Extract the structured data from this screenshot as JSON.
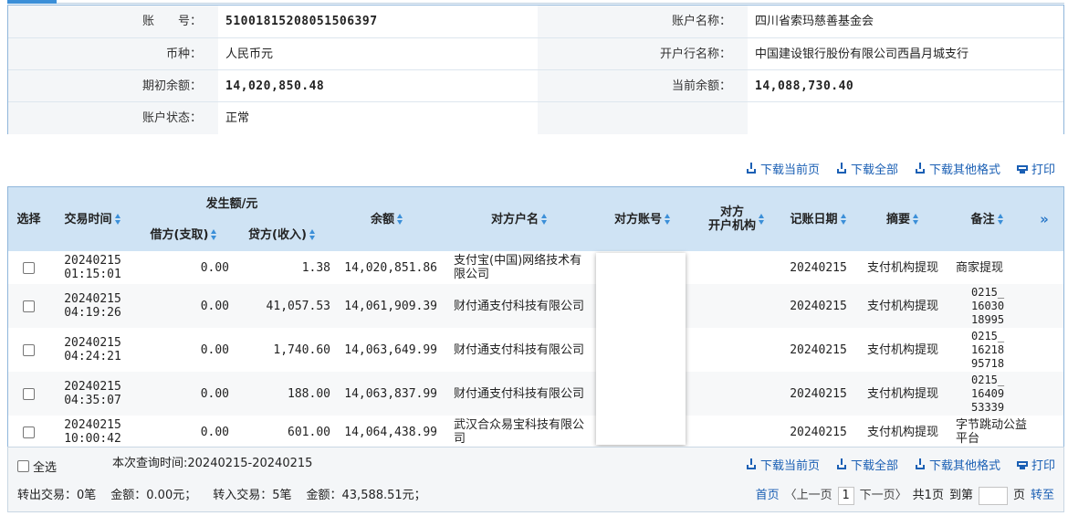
{
  "account": {
    "rows": [
      {
        "label1": "账　　号：",
        "value1": "51001815208051506397",
        "label2": "账户名称：",
        "value2": "四川省索玛慈善基金会"
      },
      {
        "label1": "币种：",
        "value1": "人民币元",
        "label2": "开户行名称：",
        "value2": "中国建设银行股份有限公司西昌月城支行"
      },
      {
        "label1": "期初余额：",
        "value1": "14,020,850.48",
        "label2": "当前余额：",
        "value2": "14,088,730.40"
      },
      {
        "label1": "账户状态：",
        "value1": "正常",
        "label2": "",
        "value2": ""
      }
    ]
  },
  "toolbar": {
    "download_page": "下载当前页",
    "download_all": "下载全部",
    "download_other": "下载其他格式",
    "print": "打印"
  },
  "table": {
    "headers": {
      "select": "选择",
      "time": "交易时间",
      "amount_group": "发生额/元",
      "debit": "借方(支取)",
      "credit": "贷方(收入)",
      "balance": "余额",
      "counterparty_name": "对方户名",
      "counterparty_account": "对方账号",
      "counterparty_bank": "对方\n开户机构",
      "post_date": "记账日期",
      "summary": "摘要",
      "remark": "备注",
      "more": "»"
    },
    "rows": [
      {
        "date": "20240215",
        "time": "01:15:01",
        "debit": "0.00",
        "credit": "1.38",
        "balance": "14,020,851.86",
        "name": "支付宝(中国)网络技术有限公司",
        "post_date": "20240215",
        "summary": "支付机构提现",
        "remark": "商家提现"
      },
      {
        "date": "20240215",
        "time": "04:19:26",
        "debit": "0.00",
        "credit": "41,057.53",
        "balance": "14,061,909.39",
        "name": "财付通支付科技有限公司",
        "post_date": "20240215",
        "summary": "支付机构提现",
        "remark": "0215_\n16030\n18995"
      },
      {
        "date": "20240215",
        "time": "04:24:21",
        "debit": "0.00",
        "credit": "1,740.60",
        "balance": "14,063,649.99",
        "name": "财付通支付科技有限公司",
        "post_date": "20240215",
        "summary": "支付机构提现",
        "remark": "0215_\n16218\n95718"
      },
      {
        "date": "20240215",
        "time": "04:35:07",
        "debit": "0.00",
        "credit": "188.00",
        "balance": "14,063,837.99",
        "name": "财付通支付科技有限公司",
        "post_date": "20240215",
        "summary": "支付机构提现",
        "remark": "0215_\n16409\n53339"
      },
      {
        "date": "20240215",
        "time": "10:00:42",
        "debit": "0.00",
        "credit": "601.00",
        "balance": "14,064,438.99",
        "name": "武汉合众易宝科技有限公司",
        "post_date": "20240215",
        "summary": "支付机构提现",
        "remark": "字节跳动公益平台"
      }
    ]
  },
  "footer": {
    "select_all": "全选",
    "query_time": "本次查询时间:20240215-20240215",
    "out_label": "转出交易：0笔",
    "out_amount": "金额：0.00元；",
    "in_label": "转入交易：5笔",
    "in_amount": "金额：43,588.51元；"
  },
  "pager": {
    "first": "首页",
    "prev": "〈上一页",
    "current": "1",
    "next": "下一页〉",
    "total": "共1页",
    "goto_prefix": "到第",
    "goto_suffix": "页",
    "go": "转至"
  }
}
